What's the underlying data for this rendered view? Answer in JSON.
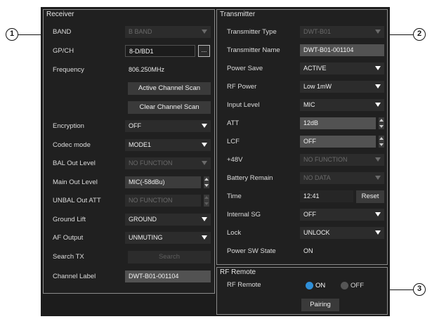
{
  "callouts": [
    "1",
    "2",
    "3"
  ],
  "receiver": {
    "title": "Receiver",
    "band": {
      "label": "BAND",
      "value": "B BAND"
    },
    "gpch": {
      "label": "GP/CH",
      "value": "8-D/BD1",
      "button": "..."
    },
    "frequency": {
      "label": "Frequency",
      "value": "806.250MHz"
    },
    "active_scan": "Active Channel Scan",
    "clear_scan": "Clear Channel Scan",
    "encryption": {
      "label": "Encryption",
      "value": "OFF"
    },
    "codec_mode": {
      "label": "Codec mode",
      "value": "MODE1"
    },
    "bal_out_level": {
      "label": "BAL Out Level",
      "value": "NO FUNCTION"
    },
    "main_out_level": {
      "label": "Main Out Level",
      "value": "MIC(-58dBu)"
    },
    "unbal_out_att": {
      "label": "UNBAL Out ATT",
      "value": "NO FUNCTION"
    },
    "ground_lift": {
      "label": "Ground Lift",
      "value": "GROUND"
    },
    "af_output": {
      "label": "AF Output",
      "value": "UNMUTING"
    },
    "search_tx": {
      "label": "Search TX",
      "button": "Search"
    },
    "channel_label": {
      "label": "Channel Label",
      "value": "DWT-B01-001104"
    }
  },
  "transmitter": {
    "title": "Transmitter",
    "type": {
      "label": "Transmitter Type",
      "value": "DWT-B01"
    },
    "name": {
      "label": "Transmitter Name",
      "value": "DWT-B01-001104"
    },
    "power_save": {
      "label": "Power Save",
      "value": "ACTIVE"
    },
    "rf_power": {
      "label": "RF Power",
      "value": "Low 1mW"
    },
    "input_level": {
      "label": "Input Level",
      "value": "MIC"
    },
    "att": {
      "label": "ATT",
      "value": "12dB"
    },
    "lcf": {
      "label": "LCF",
      "value": "OFF"
    },
    "plus48v": {
      "label": "+48V",
      "value": "NO FUNCTION"
    },
    "battery": {
      "label": "Battery Remain",
      "value": "NO DATA"
    },
    "time": {
      "label": "Time",
      "value": "12:41",
      "button": "Reset"
    },
    "internal_sg": {
      "label": "Internal SG",
      "value": "OFF"
    },
    "lock": {
      "label": "Lock",
      "value": "UNLOCK"
    },
    "power_sw_state": {
      "label": "Power SW State",
      "value": "ON"
    }
  },
  "rf_remote": {
    "title": "RF Remote",
    "label": "RF Remote",
    "on": "ON",
    "off": "OFF",
    "selected": "ON",
    "pairing": "Pairing"
  },
  "colors": {
    "radio_on": "#2f8fd8",
    "radio_off": "#555555"
  }
}
